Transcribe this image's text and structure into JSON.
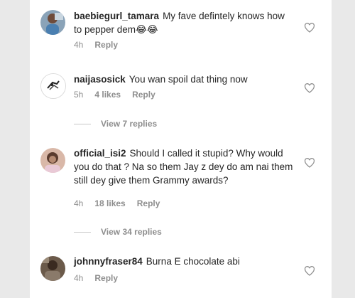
{
  "comments": [
    {
      "username": "baebiegurl_tamara",
      "text": "My fave defintely knows how to pepper dem😂😂",
      "time": "4h",
      "likes": "",
      "reply_label": "Reply",
      "avatar": "user-photo-avatar",
      "like_icon": "heart-outline-icon"
    },
    {
      "username": "naijasosick",
      "text": "You wan spoil dat thing now",
      "time": "5h",
      "likes": "4 likes",
      "reply_label": "Reply",
      "avatar": "logo-avatar",
      "like_icon": "heart-outline-icon"
    },
    {
      "username": "official_isi2",
      "text": "Should I called it stupid? Why would you do that ? Na so them Jay z dey do am nai them still dey give them Grammy awards?",
      "time": "4h",
      "likes": "18 likes",
      "reply_label": "Reply",
      "avatar": "user-photo-avatar",
      "like_icon": "heart-outline-icon"
    },
    {
      "username": "johnnyfraser84",
      "text": "Burna E chocolate abi",
      "time": "4h",
      "likes": "",
      "reply_label": "Reply",
      "avatar": "user-photo-avatar",
      "like_icon": "heart-outline-icon"
    }
  ],
  "view_replies": [
    {
      "label": "View 7 replies"
    },
    {
      "label": "View 34 replies"
    }
  ],
  "colors": {
    "text": "#262626",
    "secondary": "#8e8e8e",
    "background": "#ffffff",
    "page": "#e9e9e9"
  }
}
